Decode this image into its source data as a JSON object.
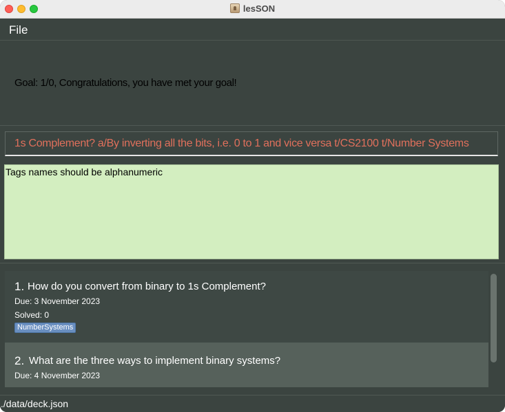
{
  "window": {
    "title": "lesSON",
    "app_icon": "app-icon"
  },
  "menu": {
    "file_label": "File"
  },
  "goal": {
    "text": "Goal: 1/0, Congratulations, you have met your goal!"
  },
  "command": {
    "value": "1s Complement? a/By inverting all the bits, i.e. 0 to 1 and vice versa t/CS2100 t/Number Systems",
    "text_color": "#e0705c"
  },
  "result": {
    "text": "Tags names should be alphanumeric",
    "background": "#d3eec0"
  },
  "cards": [
    {
      "number": "1.",
      "question": "How do you convert from binary to 1s Complement?",
      "due": "Due: 3 November 2023",
      "solved": "Solved: 0",
      "tags": [
        "NumberSystems"
      ]
    },
    {
      "number": "2.",
      "question": "What are the three ways to implement binary systems?",
      "due": "Due: 4 November 2023"
    }
  ],
  "status": {
    "path": "./data/deck.json"
  },
  "colors": {
    "window_bg": "#3b4440",
    "selected_card": "#56615b",
    "tag_bg": "#6a8fc0"
  }
}
